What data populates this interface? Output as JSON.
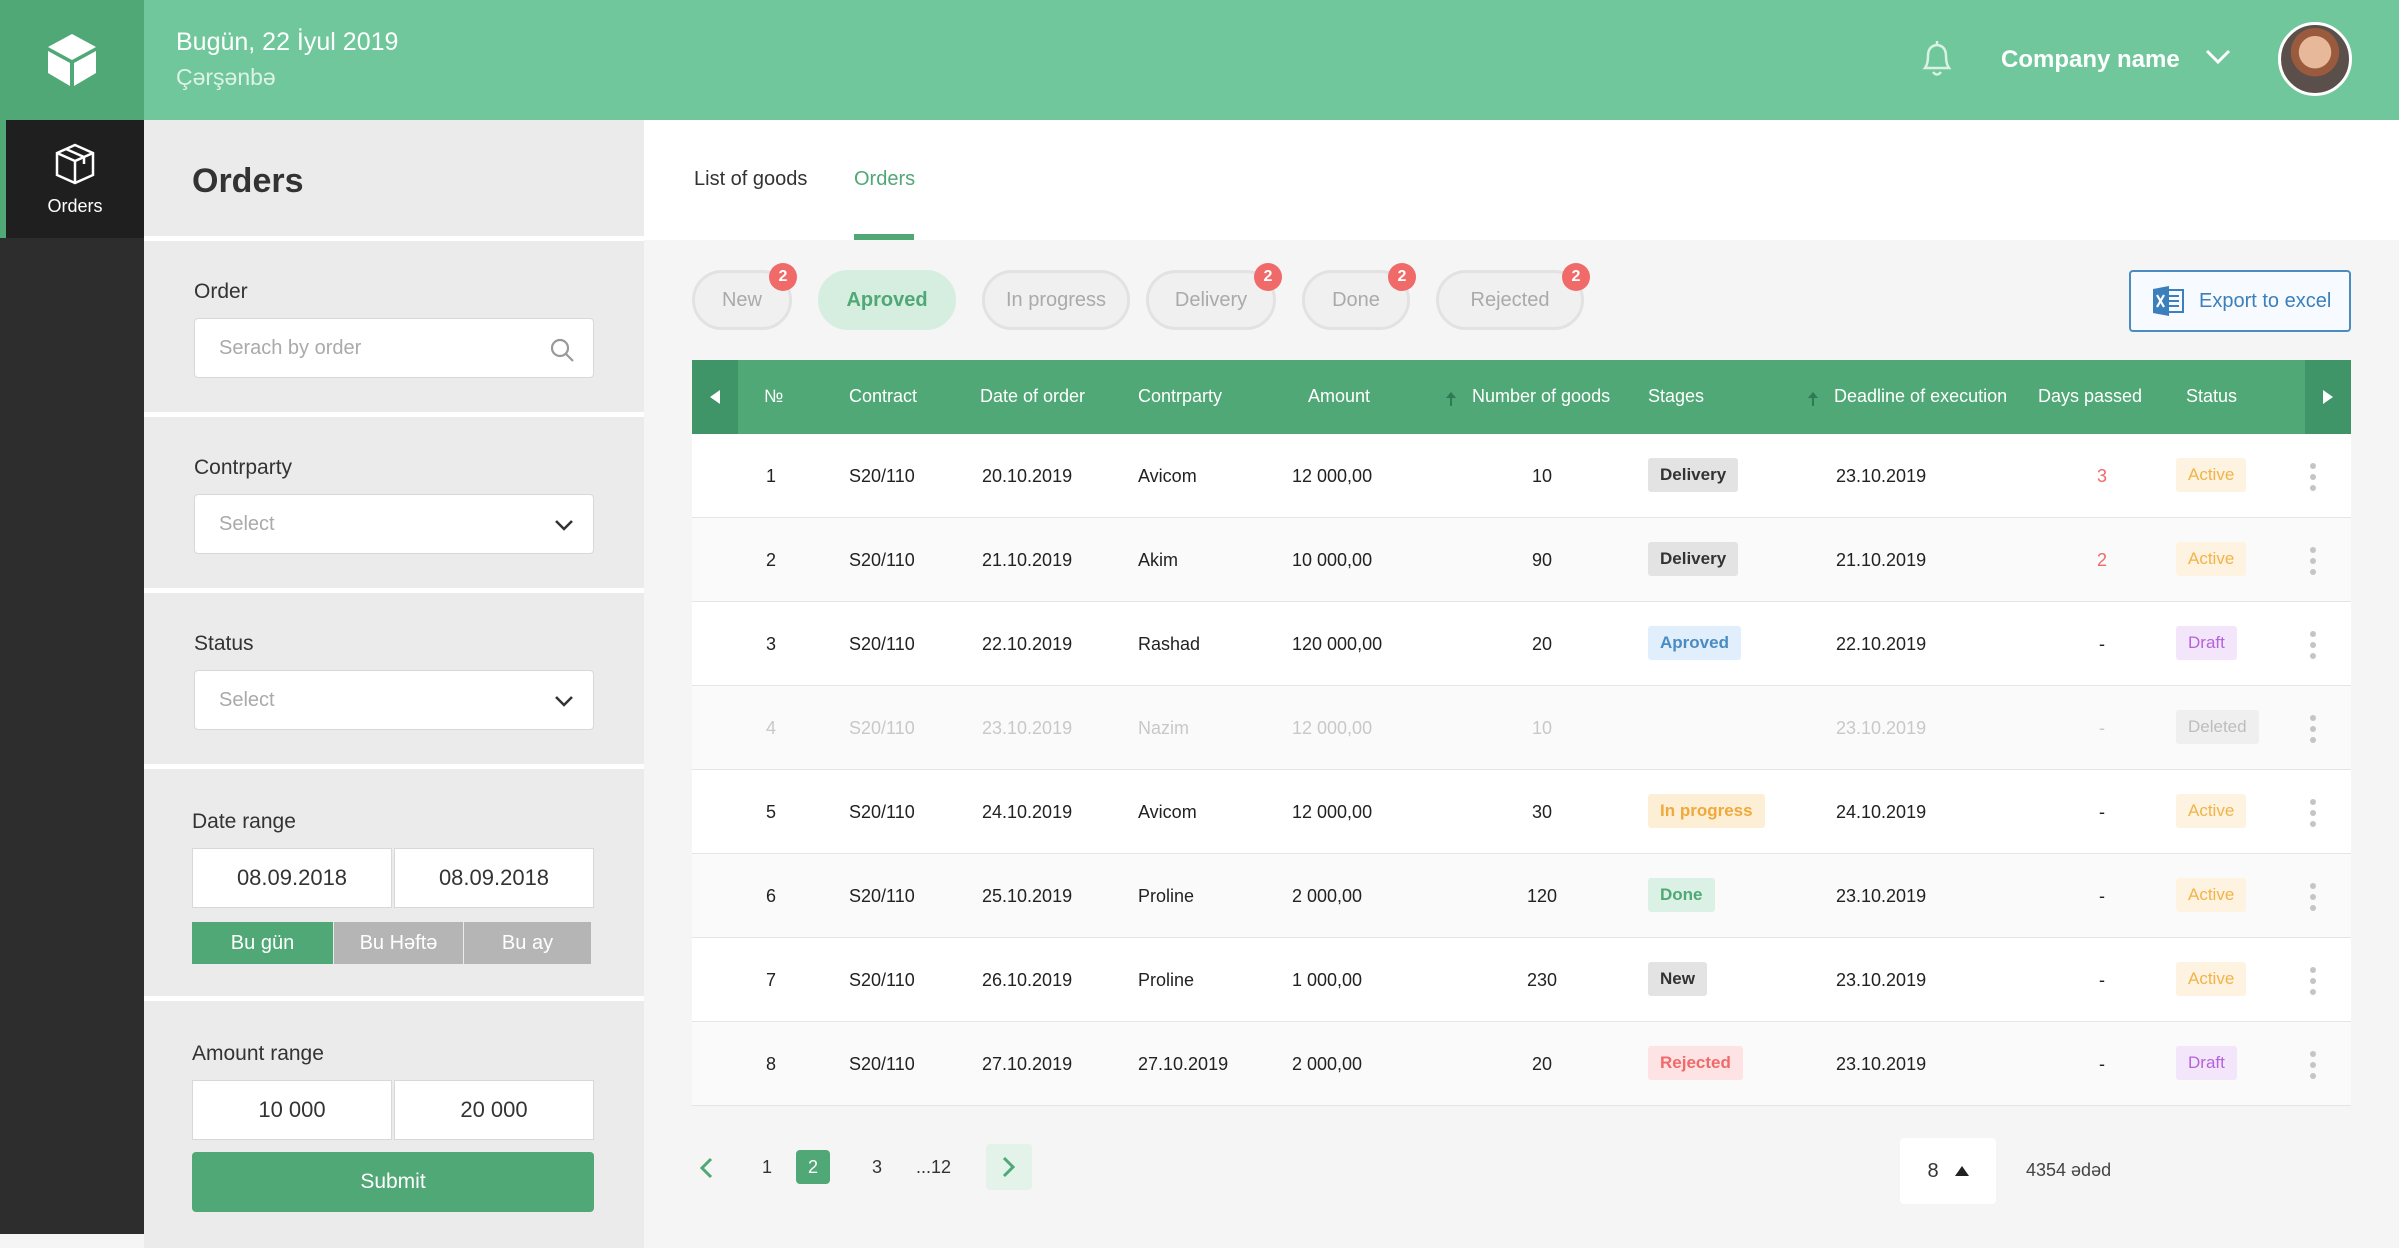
{
  "header": {
    "date": "Bugün, 22 İyul 2019",
    "weekday": "Çərşənbə",
    "company": "Company name"
  },
  "nav": {
    "orders_label": "Orders"
  },
  "filters": {
    "title": "Orders",
    "order_label": "Order",
    "order_placeholder": "Serach by order",
    "contrparty_label": "Contrparty",
    "contrparty_value": "Select",
    "status_label": "Status",
    "status_value": "Select",
    "date_range_label": "Date range",
    "date_from": "08.09.2018",
    "date_to": "08.09.2018",
    "period_today": "Bu gün",
    "period_week": "Bu Həftə",
    "period_month": "Bu ay",
    "amount_range_label": "Amount range",
    "amount_from": "10 000",
    "amount_to": "20 000",
    "submit_label": "Submit"
  },
  "tabs": {
    "goods": "List of goods",
    "orders": "Orders"
  },
  "status_filters": [
    {
      "label": "New",
      "badge": "2"
    },
    {
      "label": "Aproved",
      "badge": ""
    },
    {
      "label": "In progress",
      "badge": ""
    },
    {
      "label": "Delivery",
      "badge": "2"
    },
    {
      "label": "Done",
      "badge": "2"
    },
    {
      "label": "Rejected",
      "badge": "2"
    }
  ],
  "export_label": "Export to excel",
  "columns": {
    "num": "№",
    "contract": "Contract",
    "date": "Date of order",
    "party": "Contrparty",
    "amount": "Amount",
    "goods": "Number of goods",
    "stages": "Stages",
    "deadline": "Deadline of execution",
    "days": "Days passed",
    "status": "Status"
  },
  "rows": [
    {
      "num": "1",
      "contract": "S20/110",
      "date": "20.10.2019",
      "party": "Avicom",
      "amount": "12 000,00",
      "goods": "10",
      "stage": "Delivery",
      "deadline": "23.10.2019",
      "days": "3",
      "status": "Active"
    },
    {
      "num": "2",
      "contract": "S20/110",
      "date": "21.10.2019",
      "party": "Akim",
      "amount": "10 000,00",
      "goods": "90",
      "stage": "Delivery",
      "deadline": "21.10.2019",
      "days": "2",
      "status": "Active"
    },
    {
      "num": "3",
      "contract": "S20/110",
      "date": "22.10.2019",
      "party": "Rashad",
      "amount": "120 000,00",
      "goods": "20",
      "stage": "Aproved",
      "deadline": "22.10.2019",
      "days": "-",
      "status": "Draft"
    },
    {
      "num": "4",
      "contract": "S20/110",
      "date": "23.10.2019",
      "party": "Nazim",
      "amount": "12 000,00",
      "goods": "10",
      "stage": "",
      "deadline": "23.10.2019",
      "days": "-",
      "status": "Deleted"
    },
    {
      "num": "5",
      "contract": "S20/110",
      "date": "24.10.2019",
      "party": "Avicom",
      "amount": "12 000,00",
      "goods": "30",
      "stage": "In progress",
      "deadline": "24.10.2019",
      "days": "-",
      "status": "Active"
    },
    {
      "num": "6",
      "contract": "S20/110",
      "date": "25.10.2019",
      "party": "Proline",
      "amount": "2 000,00",
      "goods": "120",
      "stage": "Done",
      "deadline": "23.10.2019",
      "days": "-",
      "status": "Active"
    },
    {
      "num": "7",
      "contract": "S20/110",
      "date": "26.10.2019",
      "party": "Proline",
      "amount": "1 000,00",
      "goods": "230",
      "stage": "New",
      "deadline": "23.10.2019",
      "days": "-",
      "status": "Active"
    },
    {
      "num": "8",
      "contract": "S20/110",
      "date": "27.10.2019",
      "party": "27.10.2019",
      "amount": "2 000,00",
      "goods": "20",
      "stage": "Rejected",
      "deadline": "23.10.2019",
      "days": "-",
      "status": "Draft"
    }
  ],
  "pagination": {
    "p1": "1",
    "p2": "2",
    "p3": "3",
    "last": "...12"
  },
  "per_page": "8",
  "total": "4354 ədəd",
  "colors": {
    "accent": "#4fa876",
    "header": "#6fc79b",
    "badge": "#f06a6a"
  }
}
